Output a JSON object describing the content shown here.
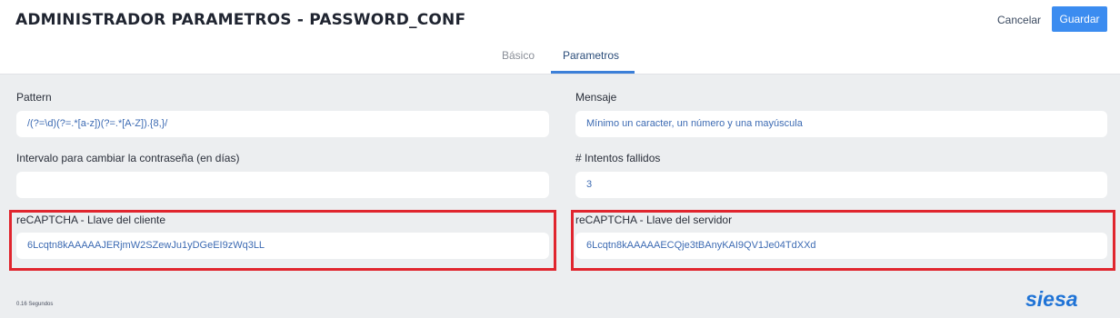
{
  "header": {
    "title": "ADMINISTRADOR PARAMETROS - PASSWORD_CONF",
    "cancel_label": "Cancelar",
    "save_label": "Guardar"
  },
  "tabs": [
    {
      "label": "Básico",
      "active": false
    },
    {
      "label": "Parametros",
      "active": true
    }
  ],
  "form": {
    "pattern": {
      "label": "Pattern",
      "value": "/(?=\\d)(?=.*[a-z])(?=.*[A-Z]).{8,}/"
    },
    "mensaje": {
      "label": "Mensaje",
      "value": "Mínimo un caracter, un número y una mayúscula"
    },
    "intervalo": {
      "label": "Intervalo para cambiar la contraseña (en días)",
      "value": ""
    },
    "intentos": {
      "label": "# Intentos fallidos",
      "value": "3"
    },
    "recaptcha_cliente": {
      "label": "reCAPTCHA - Llave del cliente",
      "value": "6Lcqtn8kAAAAAJERjmW2SZewJu1yDGeEI9zWq3LL"
    },
    "recaptcha_servidor": {
      "label": "reCAPTCHA - Llave del servidor",
      "value": "6Lcqtn8kAAAAAECQje3tBAnyKAI9QV1Je04TdXXd"
    }
  },
  "footer": {
    "timing": "0.16 Segundos",
    "brand": "siesa"
  },
  "colors": {
    "accent": "#3b8cf0",
    "highlight": "#e0252e",
    "input_text": "#3d6bb3",
    "content_bg": "#eceef0"
  }
}
